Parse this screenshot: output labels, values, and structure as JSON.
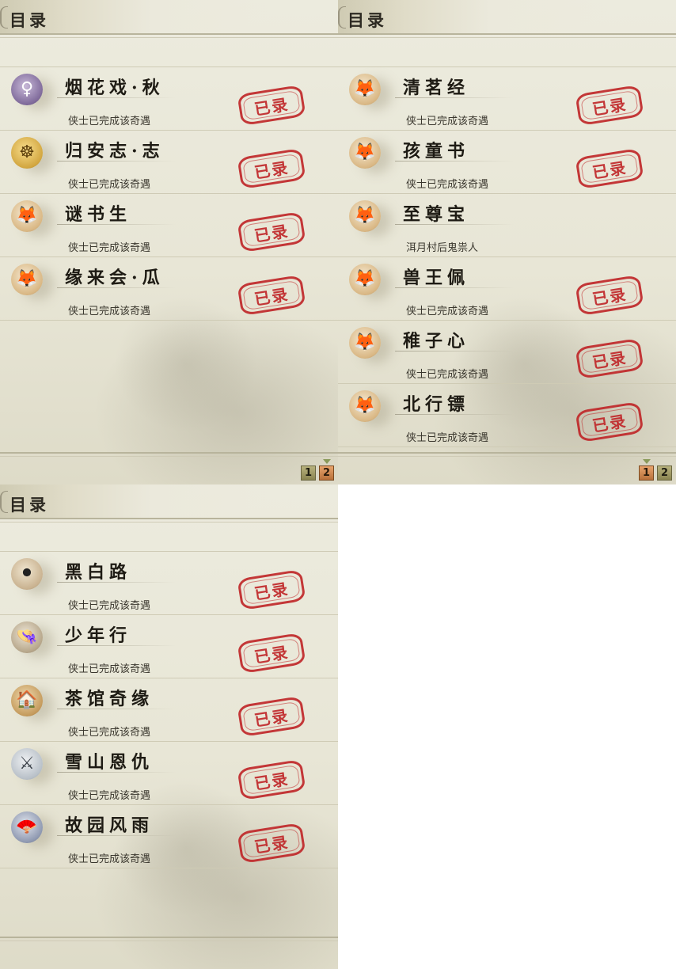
{
  "panels": [
    {
      "title": "目录",
      "items": [
        {
          "name": "烟花戏·秋",
          "status": "侠士已完成该奇遇",
          "stamp": "已录",
          "icon": "heroine-portrait-icon",
          "glyph": "♀"
        },
        {
          "name": "归安志·志",
          "status": "侠士已完成该奇遇",
          "stamp": "已录",
          "icon": "golden-buddha-icon",
          "glyph": "☸"
        },
        {
          "name": "谜书生",
          "status": "侠士已完成该奇遇",
          "stamp": "已录",
          "icon": "fox-mask-icon",
          "glyph": "🦊"
        },
        {
          "name": "缘来会·瓜",
          "status": "侠士已完成该奇遇",
          "stamp": "已录",
          "icon": "fox-mask-icon",
          "glyph": "🦊"
        }
      ],
      "pager": {
        "pages": [
          "1",
          "2"
        ],
        "current": "2"
      }
    },
    {
      "title": "目录",
      "items": [
        {
          "name": "清茗经",
          "status": "侠士已完成该奇遇",
          "stamp": "已录",
          "icon": "fox-mask-icon",
          "glyph": "🦊"
        },
        {
          "name": "孩童书",
          "status": "侠士已完成该奇遇",
          "stamp": "已录",
          "icon": "fox-mask-icon",
          "glyph": "🦊"
        },
        {
          "name": "至尊宝",
          "status": "洱月村后鬼祟人",
          "stamp": "",
          "icon": "fox-mask-icon",
          "glyph": "🦊"
        },
        {
          "name": "兽王佩",
          "status": "侠士已完成该奇遇",
          "stamp": "已录",
          "icon": "fox-mask-icon",
          "glyph": "🦊"
        },
        {
          "name": "稚子心",
          "status": "侠士已完成该奇遇",
          "stamp": "已录",
          "icon": "fox-mask-icon",
          "glyph": "🦊"
        },
        {
          "name": "北行镖",
          "status": "侠士已完成该奇遇",
          "stamp": "已录",
          "icon": "fox-mask-icon",
          "glyph": "🦊"
        }
      ],
      "pager": {
        "pages": [
          "1",
          "2"
        ],
        "current": "1"
      }
    },
    {
      "title": "目录",
      "items": [
        {
          "name": "黑白路",
          "status": "侠士已完成该奇遇",
          "stamp": "已录",
          "icon": "go-board-icon",
          "glyph": "⚫"
        },
        {
          "name": "少年行",
          "status": "侠士已完成该奇遇",
          "stamp": "已录",
          "icon": "straw-hat-boy-icon",
          "glyph": "👒"
        },
        {
          "name": "茶馆奇缘",
          "status": "侠士已完成该奇遇",
          "stamp": "已录",
          "icon": "teahouse-icon",
          "glyph": "🏠"
        },
        {
          "name": "雪山恩仇",
          "status": "侠士已完成该奇遇",
          "stamp": "已录",
          "icon": "crossed-swords-icon",
          "glyph": "⚔"
        },
        {
          "name": "故园风雨",
          "status": "侠士已完成该奇遇",
          "stamp": "已录",
          "icon": "folding-fan-icon",
          "glyph": "🪭"
        }
      ],
      "pager": {
        "pages": [],
        "current": ""
      }
    }
  ],
  "colors": {
    "stamp_red": "#c0282a",
    "text_dark": "#1e1b14",
    "parchment": "#e8e6d6"
  }
}
